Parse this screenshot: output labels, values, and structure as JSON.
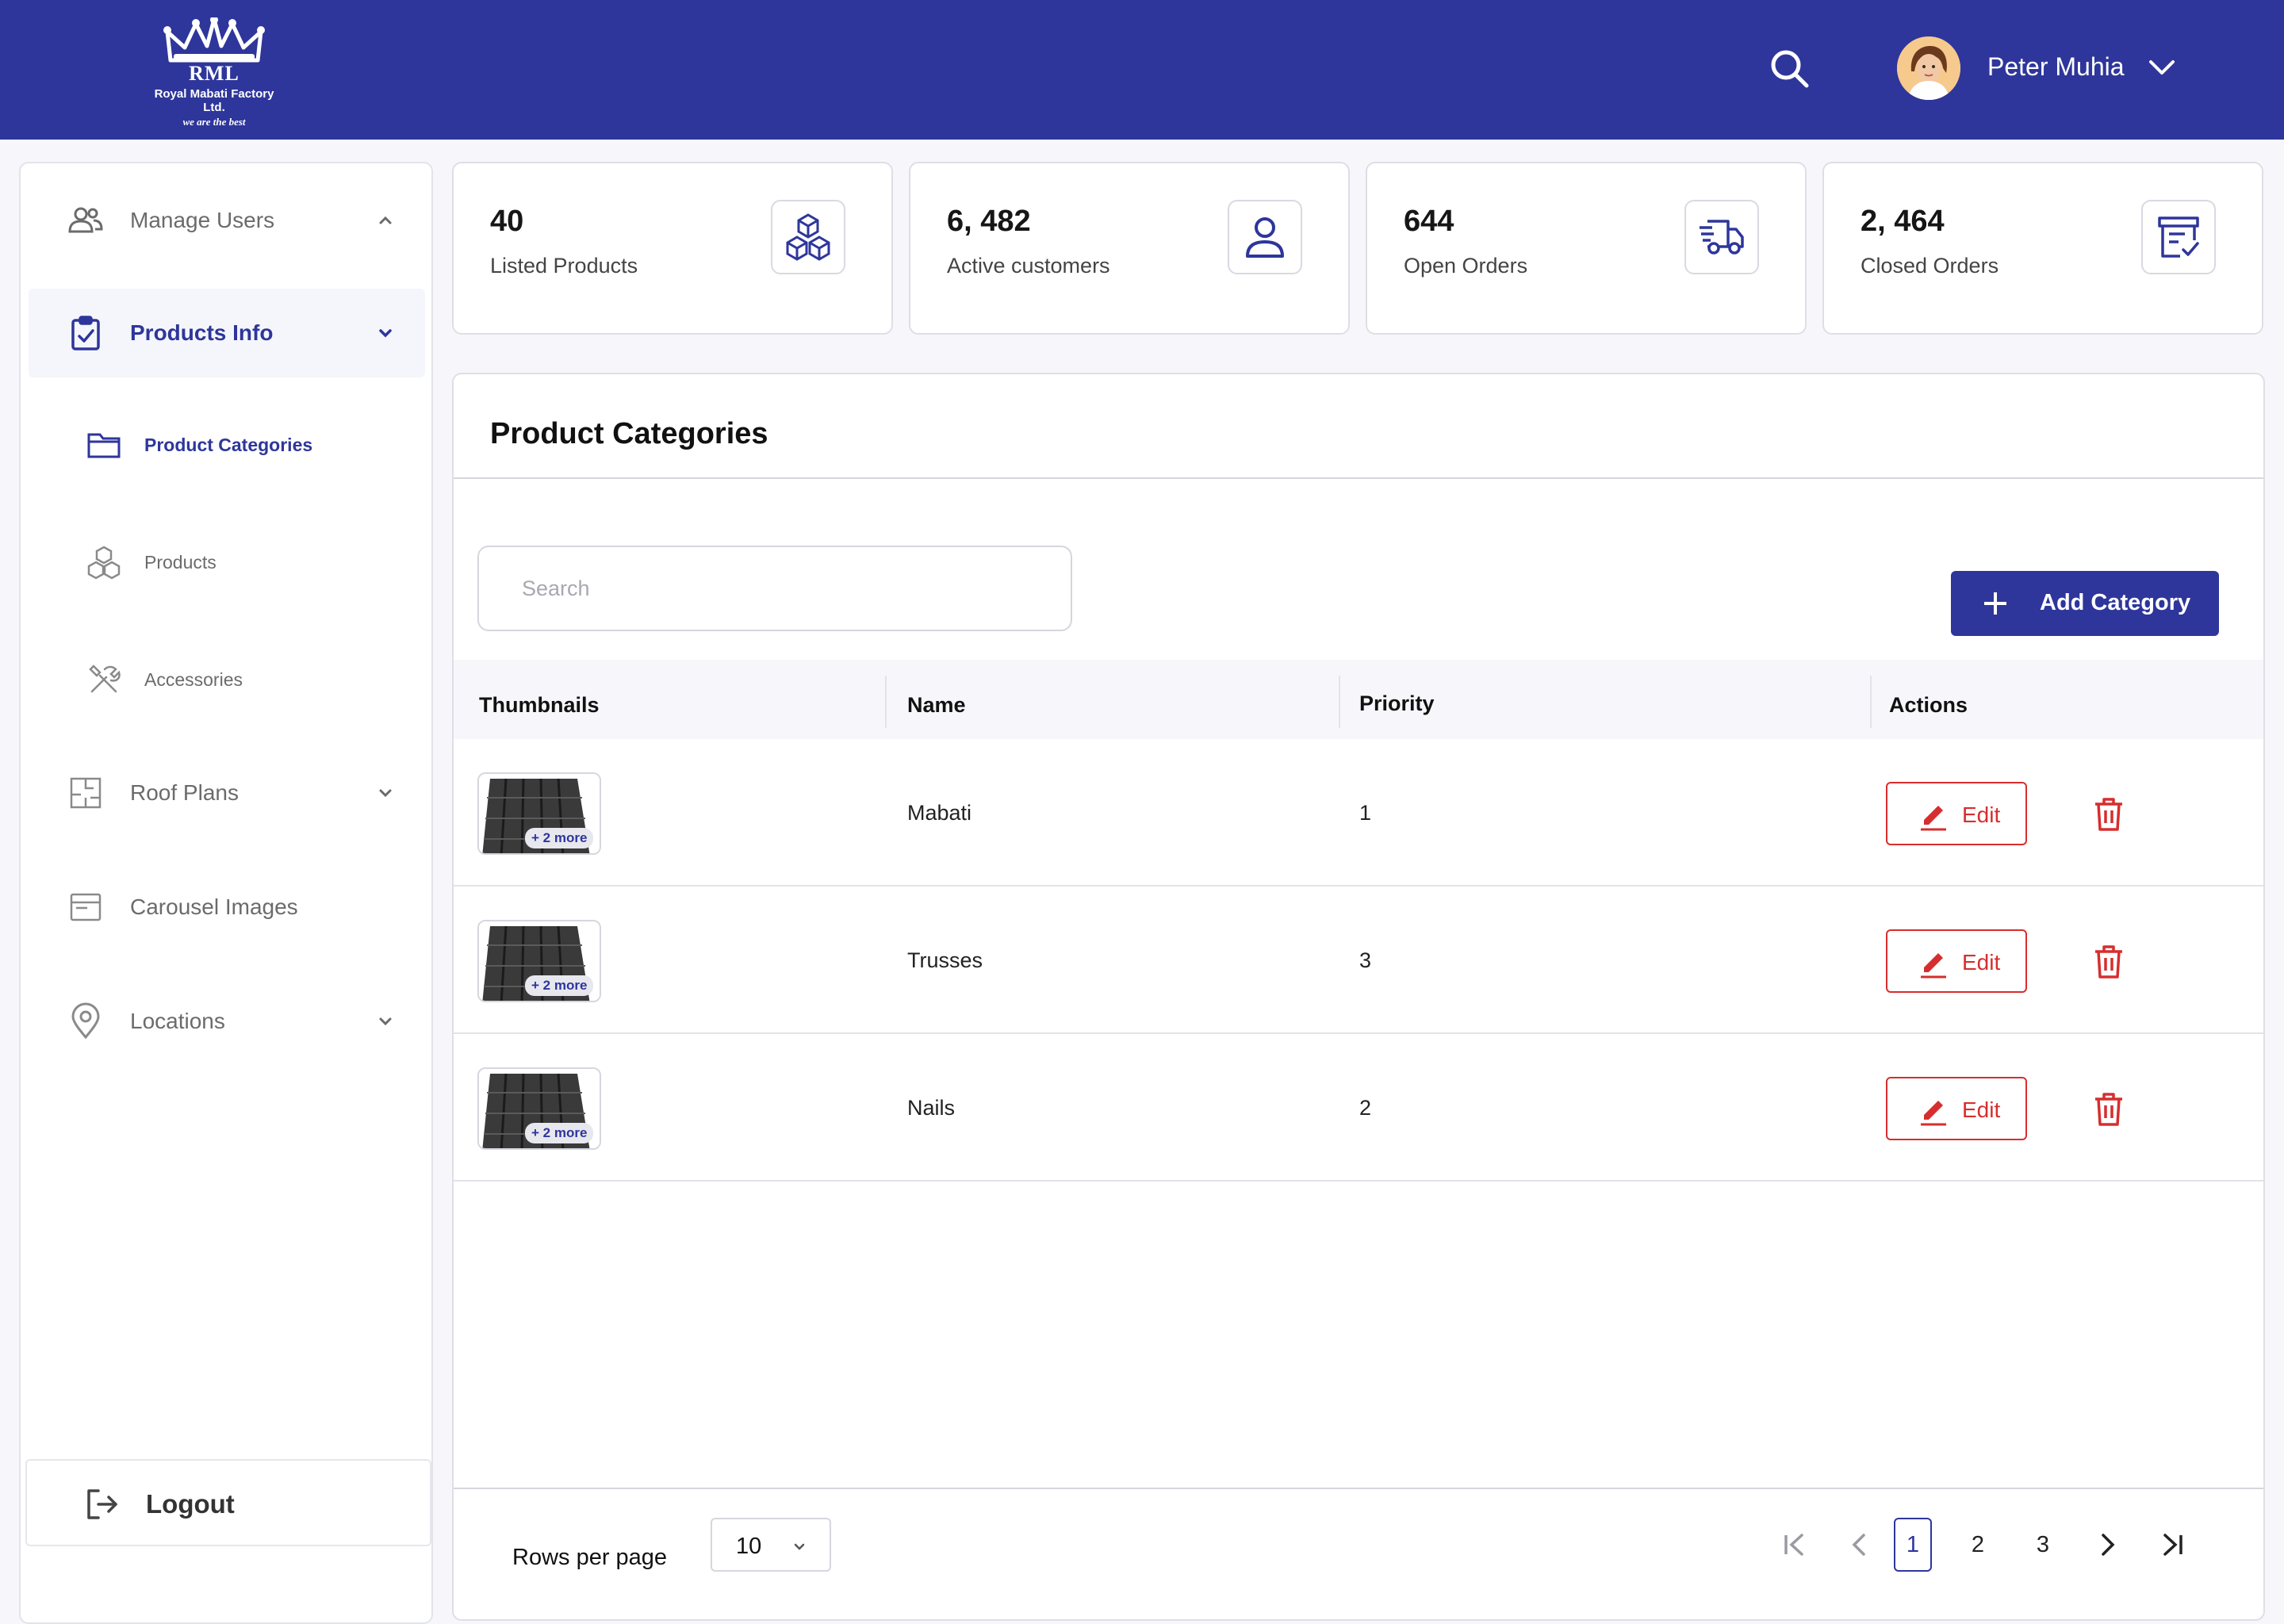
{
  "brand": {
    "abbr": "RML",
    "company": "Royal Mabati Factory Ltd.",
    "tagline": "we are the best"
  },
  "header": {
    "user_name": "Peter Muhia",
    "icons": {
      "search": "search-icon",
      "user_menu": "chevron-down-icon"
    }
  },
  "sidebar": {
    "items": [
      {
        "label": "Manage Users",
        "icon": "users-icon",
        "expanded": true
      },
      {
        "label": "Products Info",
        "icon": "clipboard-check-icon",
        "expanded": true,
        "active": true
      },
      {
        "label": "Roof Plans",
        "icon": "floor-plan-icon"
      },
      {
        "label": "Carousel Images",
        "icon": "browser-window-icon"
      },
      {
        "label": "Locations",
        "icon": "location-pin-icon"
      }
    ],
    "sub_items": [
      {
        "label": "Product Categories",
        "icon": "folder-icon",
        "current": true
      },
      {
        "label": "Products",
        "icon": "cubes-icon"
      },
      {
        "label": "Accessories",
        "icon": "tools-icon"
      }
    ],
    "logout_label": "Logout"
  },
  "stats": [
    {
      "value": "40",
      "label": "Listed Products",
      "icon": "cubes-icon"
    },
    {
      "value": "6, 482",
      "label": "Active customers",
      "icon": "user-icon"
    },
    {
      "value": "644",
      "label": "Open Orders",
      "icon": "delivery-truck-icon"
    },
    {
      "value": "2, 464",
      "label": "Closed Orders",
      "icon": "archive-check-icon"
    }
  ],
  "panel": {
    "title": "Product Categories",
    "search_placeholder": "Search",
    "add_button_label": "Add Category",
    "columns": [
      "Thumbnails",
      "Name",
      "Priority",
      "Actions"
    ],
    "rows": [
      {
        "more": "+ 2 more",
        "name": "Mabati",
        "priority": "1",
        "edit_label": "Edit"
      },
      {
        "more": "+ 2 more",
        "name": "Trusses",
        "priority": "3",
        "edit_label": "Edit"
      },
      {
        "more": "+ 2 more",
        "name": "Nails",
        "priority": "2",
        "edit_label": "Edit"
      }
    ],
    "footer": {
      "rows_per_page_label": "Rows per page",
      "rows_per_page_value": "10",
      "pages": [
        "1",
        "2",
        "3"
      ],
      "current_page": "1"
    }
  },
  "colors": {
    "brand_blue": "#2e369b",
    "danger_red": "#d62e2e",
    "background": "#f7f7fb"
  }
}
